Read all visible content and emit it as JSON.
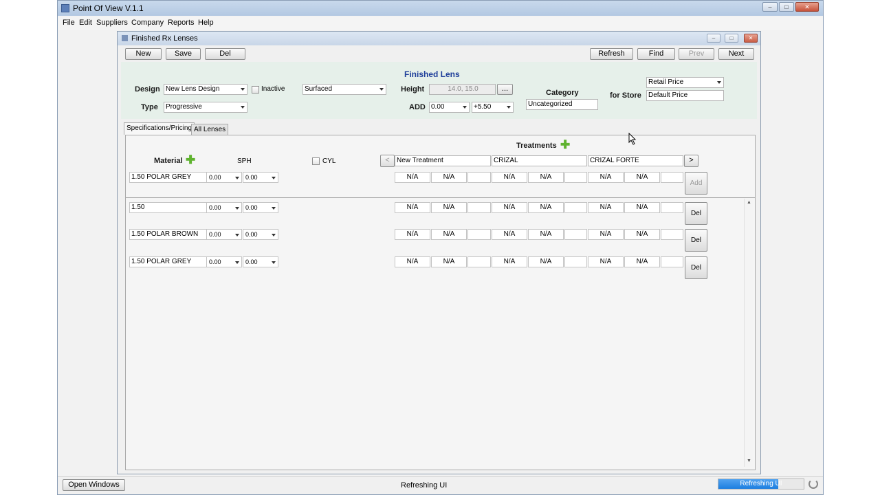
{
  "app": {
    "title": "Point Of View V.1.1",
    "menu": [
      "File",
      "Edit",
      "Suppliers",
      "Company",
      "Reports",
      "Help"
    ]
  },
  "frame": {
    "title": "Finished Rx Lenses",
    "toolbar": {
      "new": "New",
      "save": "Save",
      "del": "Del",
      "refresh": "Refresh",
      "find": "Find",
      "prev": "Prev",
      "next": "Next"
    }
  },
  "header": {
    "heading": "Finished Lens",
    "design_label": "Design",
    "design_value": "New Lens Design",
    "inactive_label": "Inactive",
    "process_value": "Surfaced",
    "height_label": "Height",
    "height_value": "14.0, 15.0",
    "height_btn": "...",
    "category_label": "Category",
    "category_value": "Uncategorized",
    "for_store_label": "for Store",
    "price_type": "Retail Price",
    "store_value": "Default Price",
    "type_label": "Type",
    "type_value": "Progressive",
    "add_label": "ADD",
    "add_from": "0.00",
    "add_to": "+5.50"
  },
  "tabs": [
    "Specifications/Pricing",
    "All Lenses"
  ],
  "grid": {
    "treatments_label": "Treatments",
    "material_label": "Material",
    "sph_label": "SPH",
    "cyl_label": "CYL",
    "prev_btn": "<",
    "next_btn": ">",
    "treatment_columns": [
      "New Treatment",
      "CRIZAL",
      "CRIZAL FORTE"
    ],
    "new_row": {
      "material": "1.50 POLAR GREY",
      "sph1": "0.00",
      "sph2": "0.00",
      "cells": [
        "N/A",
        "N/A",
        "",
        "N/A",
        "N/A",
        "",
        "N/A",
        "N/A",
        ""
      ],
      "action": "Add"
    },
    "rows": [
      {
        "material": "1.50",
        "sph1": "0.00",
        "sph2": "0.00",
        "cells": [
          "N/A",
          "N/A",
          "",
          "N/A",
          "N/A",
          "",
          "N/A",
          "N/A",
          ""
        ],
        "action": "Del"
      },
      {
        "material": "1.50 POLAR BROWN",
        "sph1": "0.00",
        "sph2": "0.00",
        "cells": [
          "N/A",
          "N/A",
          "",
          "N/A",
          "N/A",
          "",
          "N/A",
          "N/A",
          ""
        ],
        "action": "Del"
      },
      {
        "material": "1.50 POLAR GREY",
        "sph1": "0.00",
        "sph2": "0.00",
        "cells": [
          "N/A",
          "N/A",
          "",
          "N/A",
          "N/A",
          "",
          "N/A",
          "N/A",
          ""
        ],
        "action": "Del"
      }
    ]
  },
  "status": {
    "open_windows": "Open Windows",
    "message": "Refreshing UI",
    "progress_text": "Refreshing UI",
    "progress_fraction": 0.7
  },
  "colors": {
    "heading": "#1f3f9a",
    "header_bg": "#e6f0ea",
    "progress": "#1d7ee0"
  }
}
